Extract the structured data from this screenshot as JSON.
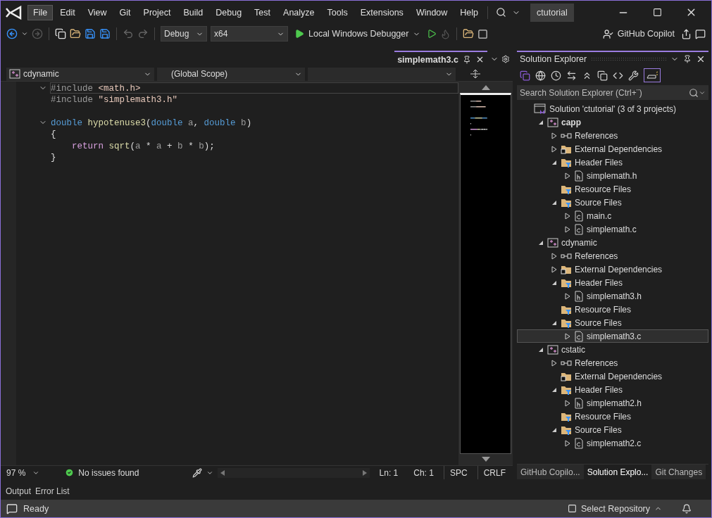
{
  "menu": [
    {
      "label": "File",
      "selected": true
    },
    {
      "label": "Edit",
      "selected": false
    },
    {
      "label": "View",
      "selected": false
    },
    {
      "label": "Git",
      "selected": false
    },
    {
      "label": "Project",
      "selected": false
    },
    {
      "label": "Build",
      "selected": false
    },
    {
      "label": "Debug",
      "selected": false
    },
    {
      "label": "Test",
      "selected": false
    },
    {
      "label": "Analyze",
      "selected": false
    },
    {
      "label": "Tools",
      "selected": false
    },
    {
      "label": "Extensions",
      "selected": false
    },
    {
      "label": "Window",
      "selected": false
    },
    {
      "label": "Help",
      "selected": false
    }
  ],
  "solution_name": "ctutorial",
  "toolbar": {
    "configuration": "Debug",
    "platform": "x64",
    "debugger": "Local Windows Debugger",
    "copilot": "GitHub Copilot"
  },
  "editor": {
    "tab": {
      "label": "simplemath3.c",
      "selected": true
    },
    "nav": {
      "project": "cdynamic",
      "scope": "(Global Scope)"
    },
    "lines": [
      {
        "kind": "code",
        "expanded": true,
        "tokens": [
          {
            "kind": "directive",
            "text": "#include "
          },
          {
            "kind": "string",
            "text": "<math.h>"
          }
        ]
      },
      {
        "kind": "code",
        "tokens": [
          {
            "kind": "directive",
            "text": "#include "
          },
          {
            "kind": "string",
            "text": "\"simplemath3.h\""
          }
        ]
      },
      {
        "kind": "blank"
      },
      {
        "kind": "code",
        "expanded": true,
        "tokens": [
          {
            "kind": "keyword",
            "text": "double "
          },
          {
            "kind": "function",
            "text": "hypotenuse3"
          },
          {
            "kind": "plain",
            "text": "("
          },
          {
            "kind": "keyword",
            "text": "double "
          },
          {
            "kind": "param",
            "text": "a"
          },
          {
            "kind": "plain",
            "text": ", "
          },
          {
            "kind": "keyword",
            "text": "double "
          },
          {
            "kind": "param",
            "text": "b"
          },
          {
            "kind": "plain",
            "text": ")"
          }
        ]
      },
      {
        "kind": "code",
        "tokens": [
          {
            "kind": "plain",
            "text": "{"
          }
        ]
      },
      {
        "kind": "code",
        "tokens": [
          {
            "kind": "control",
            "text": "    return "
          },
          {
            "kind": "function",
            "text": "sqrt"
          },
          {
            "kind": "plain",
            "text": "("
          },
          {
            "kind": "param",
            "text": "a"
          },
          {
            "kind": "plain",
            "text": " * "
          },
          {
            "kind": "param",
            "text": "a"
          },
          {
            "kind": "plain",
            "text": " + "
          },
          {
            "kind": "param",
            "text": "b"
          },
          {
            "kind": "plain",
            "text": " * "
          },
          {
            "kind": "param",
            "text": "b"
          },
          {
            "kind": "plain",
            "text": ");"
          }
        ]
      },
      {
        "kind": "code",
        "tokens": [
          {
            "kind": "plain",
            "text": "}"
          }
        ]
      }
    ],
    "status": {
      "zoom": "97 %",
      "issues": "No issues found",
      "line": "Ln: 1",
      "column": "Ch: 1",
      "whitespace": "SPC",
      "line_ending": "CRLF"
    }
  },
  "solution_explorer": {
    "title": "Solution Explorer",
    "search": {
      "placeholder": "Search Solution Explorer (Ctrl+¨)"
    },
    "tree": [
      {
        "kind": "solution",
        "label": "Solution 'ctutorial' (3 of 3 projects)",
        "selected": false,
        "children": [
          {
            "kind": "project",
            "label": "capp",
            "bold": true,
            "expanded": true,
            "selected": false,
            "children": [
              {
                "kind": "references",
                "label": "References",
                "expanded": false,
                "selected": false
              },
              {
                "kind": "external",
                "label": "External Dependencies",
                "expanded": false,
                "selected": false
              },
              {
                "kind": "filter",
                "label": "Header Files",
                "expanded": true,
                "selected": false,
                "children": [
                  {
                    "kind": "header",
                    "label": "simplemath.h",
                    "expanded": false,
                    "selected": false
                  }
                ]
              },
              {
                "kind": "filter",
                "label": "Resource Files",
                "selected": false
              },
              {
                "kind": "filter",
                "label": "Source Files",
                "expanded": true,
                "selected": false,
                "children": [
                  {
                    "kind": "source",
                    "label": "main.c",
                    "expanded": false,
                    "selected": false
                  },
                  {
                    "kind": "source",
                    "label": "simplemath.c",
                    "expanded": false,
                    "selected": false
                  }
                ]
              }
            ]
          },
          {
            "kind": "project",
            "label": "cdynamic",
            "bold": false,
            "expanded": true,
            "selected": false,
            "children": [
              {
                "kind": "references",
                "label": "References",
                "expanded": false,
                "selected": false
              },
              {
                "kind": "external",
                "label": "External Dependencies",
                "expanded": false,
                "selected": false
              },
              {
                "kind": "filter",
                "label": "Header Files",
                "expanded": true,
                "selected": false,
                "children": [
                  {
                    "kind": "header",
                    "label": "simplemath3.h",
                    "expanded": false,
                    "selected": false
                  }
                ]
              },
              {
                "kind": "filter",
                "label": "Resource Files",
                "selected": false
              },
              {
                "kind": "filter",
                "label": "Source Files",
                "expanded": true,
                "selected": false,
                "children": [
                  {
                    "kind": "source",
                    "label": "simplemath3.c",
                    "expanded": false,
                    "selected": true
                  }
                ]
              }
            ]
          },
          {
            "kind": "project",
            "label": "cstatic",
            "bold": false,
            "expanded": true,
            "selected": false,
            "children": [
              {
                "kind": "references",
                "label": "References",
                "expanded": false,
                "selected": false
              },
              {
                "kind": "external",
                "label": "External Dependencies",
                "selected": false
              },
              {
                "kind": "filter",
                "label": "Header Files",
                "expanded": true,
                "selected": false,
                "children": [
                  {
                    "kind": "header",
                    "label": "simplemath2.h",
                    "expanded": false,
                    "selected": false
                  }
                ]
              },
              {
                "kind": "filter",
                "label": "Resource Files",
                "selected": false
              },
              {
                "kind": "filter",
                "label": "Source Files",
                "expanded": true,
                "selected": false,
                "children": [
                  {
                    "kind": "source",
                    "label": "simplemath2.c",
                    "expanded": false,
                    "selected": false
                  }
                ]
              }
            ]
          }
        ]
      }
    ],
    "tabs": [
      {
        "label": "GitHub Copilo...",
        "selected": false
      },
      {
        "label": "Solution Explo...",
        "selected": true
      },
      {
        "label": "Git Changes",
        "selected": false
      }
    ]
  },
  "bottom_tabs": [
    {
      "label": "Output"
    },
    {
      "label": "Error List"
    }
  ],
  "status_bar": {
    "message": "Ready",
    "repository": "Select Repository"
  }
}
